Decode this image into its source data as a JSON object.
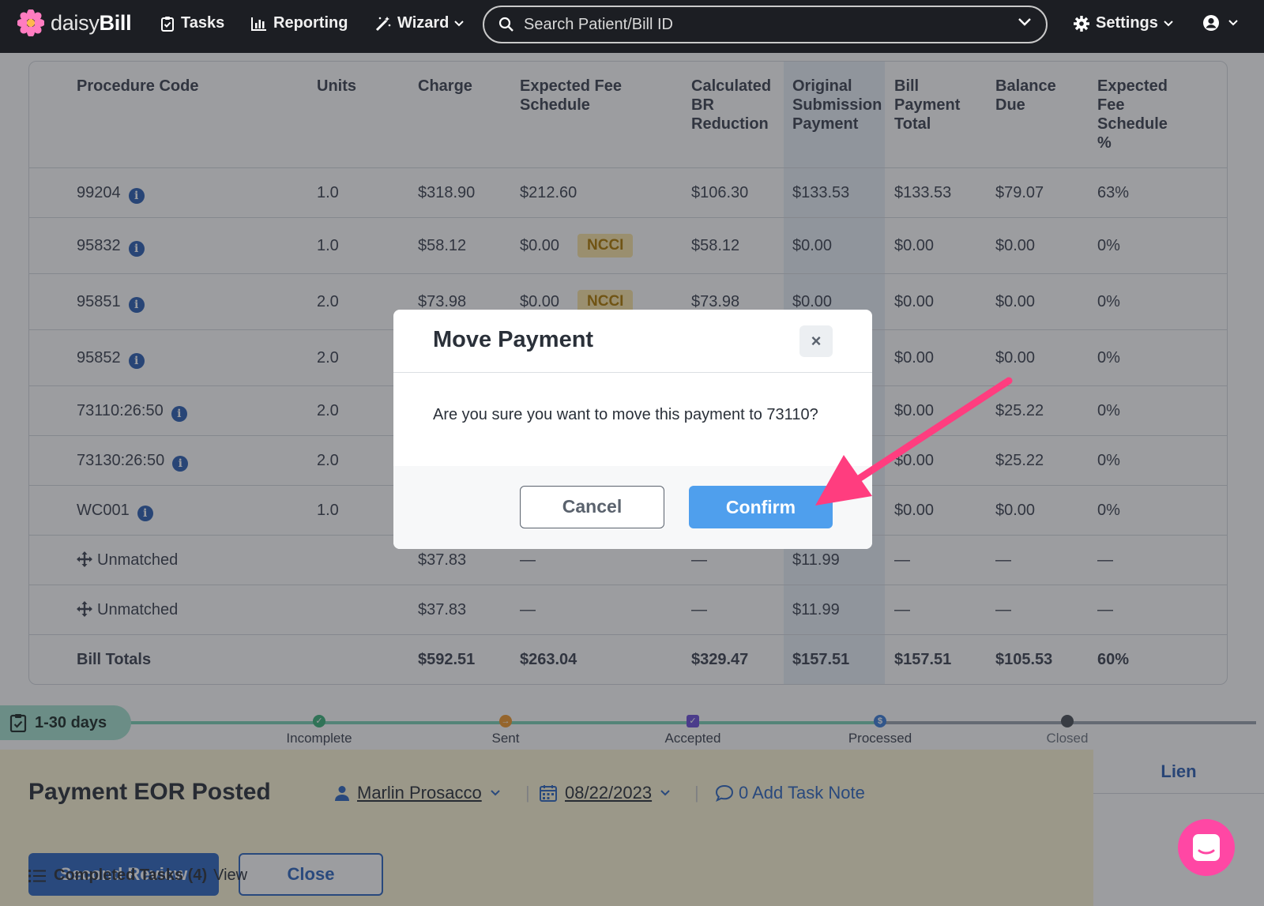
{
  "nav": {
    "logo_prefix": "daisy",
    "logo_suffix": "Bill",
    "tasks": "Tasks",
    "reporting": "Reporting",
    "wizard": "Wizard",
    "search_placeholder": "Search Patient/Bill ID",
    "settings": "Settings"
  },
  "table": {
    "headers": {
      "code": "Procedure Code",
      "units": "Units",
      "charge": "Charge",
      "efs": "Expected Fee Schedule",
      "calc": "Calculated BR Reduction",
      "orig": "Original Submission Payment",
      "bill": "Bill Payment Total",
      "bal": "Balance Due",
      "pct": "Expected Fee Schedule %"
    },
    "rows": [
      {
        "code": "99204",
        "units": "1.0",
        "charge": "$318.90",
        "efs": "$212.60",
        "badge": "",
        "calc": "$106.30",
        "orig": "$133.53",
        "bill": "$133.53",
        "bal": "$79.07",
        "pct": "63%"
      },
      {
        "code": "95832",
        "units": "1.0",
        "charge": "$58.12",
        "efs": "$0.00",
        "badge": "NCCI",
        "calc": "$58.12",
        "orig": "$0.00",
        "bill": "$0.00",
        "bal": "$0.00",
        "pct": "0%"
      },
      {
        "code": "95851",
        "units": "2.0",
        "charge": "$73.98",
        "efs": "$0.00",
        "badge": "NCCI",
        "calc": "$73.98",
        "orig": "$0.00",
        "bill": "$0.00",
        "bal": "$0.00",
        "pct": "0%"
      },
      {
        "code": "95852",
        "units": "2.0",
        "bill": "$0.00",
        "bal": "$0.00",
        "pct": "0%"
      },
      {
        "code": "73110:26:50",
        "units": "2.0",
        "bill": "$0.00",
        "bal": "$25.22",
        "pct": "0%"
      },
      {
        "code": "73130:26:50",
        "units": "2.0",
        "bill": "$0.00",
        "bal": "$25.22",
        "pct": "0%"
      },
      {
        "code": "WC001",
        "units": "1.0",
        "bill": "$0.00",
        "bal": "$0.00",
        "pct": "0%"
      }
    ],
    "unmatched": [
      {
        "label": "Unmatched",
        "charge": "$37.83",
        "efs": "—",
        "calc": "—",
        "orig": "$11.99",
        "bill": "—",
        "bal": "—",
        "pct": "—"
      },
      {
        "label": "Unmatched",
        "charge": "$37.83",
        "efs": "—",
        "calc": "—",
        "orig": "$11.99",
        "bill": "—",
        "bal": "—",
        "pct": "—"
      }
    ],
    "totals": {
      "label": "Bill Totals",
      "charge": "$592.51",
      "efs": "$263.04",
      "calc": "$329.47",
      "orig": "$157.51",
      "bill": "$157.51",
      "bal": "$105.53",
      "pct": "60%"
    }
  },
  "task": {
    "days": "1-30 days",
    "steps": [
      "Incomplete",
      "Sent",
      "Accepted",
      "Processed",
      "Closed"
    ],
    "lien": "Lien",
    "title": "Payment EOR Posted",
    "assignee": "Marlin Prosacco",
    "date": "08/22/2023",
    "note": "0 Add Task Note",
    "second_review": "Second Review",
    "close": "Close",
    "completed_label": "Completed Tasks (4)",
    "completed_view": "View"
  },
  "modal": {
    "title": "Move Payment",
    "close_glyph": "×",
    "message": "Are you sure you want to move this payment to 73110?",
    "cancel": "Cancel",
    "confirm": "Confirm"
  },
  "colors": {
    "nav_bg": "#1c1e23",
    "primary": "#2f67bf",
    "confirm": "#4f9fed",
    "arrow": "#ff3d7f",
    "ncci_bg": "#fbe6a6",
    "task_bg": "#fdf6d6",
    "chat": "#ff47a4"
  }
}
